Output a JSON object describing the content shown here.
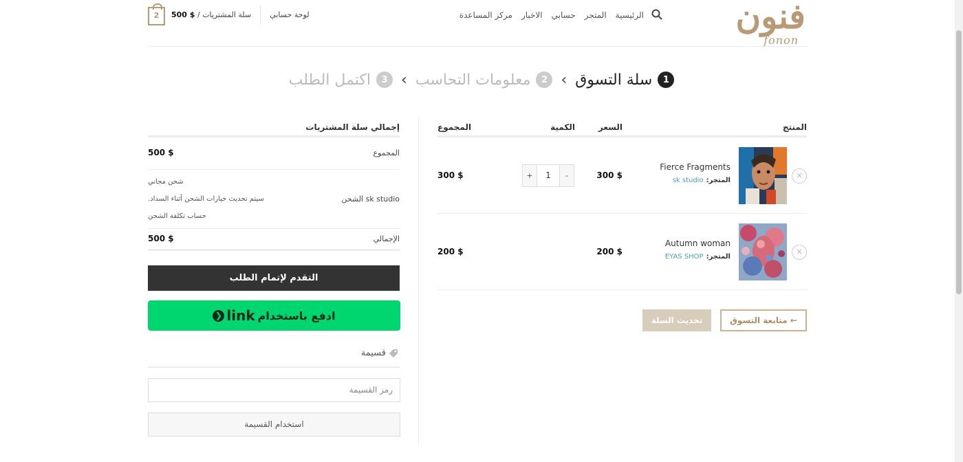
{
  "header": {
    "logo_mark": "فنون",
    "logo_word": "fonon",
    "nav": [
      "الرئيسية",
      "المتجر",
      "حسابي",
      "الاخبار",
      "مركز المساعدة"
    ],
    "cart_label": "سلة المشتريات /",
    "cart_amount": "$ 500",
    "cart_count": "2",
    "account_link": "لوحة حسابي"
  },
  "steps": [
    {
      "num": "1",
      "label": "سلة التسوق"
    },
    {
      "num": "2",
      "label": "معلومات التحاسب"
    },
    {
      "num": "3",
      "label": "اكتمل الطلب"
    }
  ],
  "cart": {
    "headers": {
      "product": "المنتج",
      "price": "السعر",
      "quantity": "الكمية",
      "subtotal": "المجموع"
    },
    "vendor_label": "المتجر:",
    "items": [
      {
        "name": "Fierce Fragments",
        "vendor": "sk studio",
        "price": "300 $",
        "quantity": "1",
        "subtotal": "300 $"
      },
      {
        "name": "Autumn woman",
        "vendor": "EYAS SHOP",
        "price": "200 $",
        "subtotal": "200 $"
      }
    ],
    "qty_minus": "-",
    "qty_plus": "+",
    "remove_symbol": "×",
    "continue_label": "← متابعة التسوق",
    "update_label": "تحديث السلة"
  },
  "totals": {
    "title": "إجمالي سلة المشتريات",
    "subtotal_label": "المجموع",
    "subtotal_value": "500 $",
    "shipping_label": "sk studio الشحن",
    "shipping_lines": [
      "شحن مجاني",
      "سيتم تحديث خيارات الشحن أثناء السداد.",
      "حساب تكلفة الشحن"
    ],
    "total_label": "الإجمالي",
    "total_value": "500 $",
    "checkout_label": "التقدم لإتمام الطلب",
    "link_pay_label": "ادفع باستخدام",
    "link_brand": "link",
    "coupon_title": "قسيمة",
    "coupon_placeholder": "رمز القسيمة",
    "coupon_button": "استخدام القسيمة"
  },
  "colors": {
    "accent": "#b99a74",
    "link_green": "#00d66f",
    "vendor_link": "#4a9ec9"
  }
}
